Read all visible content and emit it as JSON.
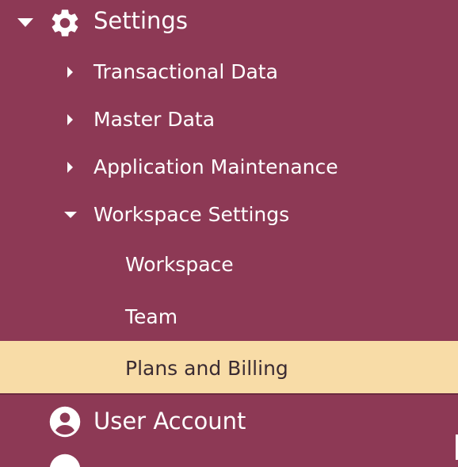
{
  "nav": {
    "settings": {
      "label": "Settings",
      "icon": "gear-icon"
    },
    "settings_children": [
      {
        "label": "Transactional Data"
      },
      {
        "label": "Master Data"
      },
      {
        "label": "Application Maintenance"
      }
    ],
    "workspace_settings": {
      "label": "Workspace Settings",
      "children": [
        {
          "label": "Workspace"
        },
        {
          "label": "Team"
        },
        {
          "label": "Plans and Billing",
          "selected": true
        }
      ]
    },
    "user_account": {
      "label": "User Account",
      "icon": "user-circle-icon"
    },
    "colors": {
      "sidebar_bg": "#8d3955",
      "selected_bg": "#f8dca7",
      "text": "#ffffff",
      "selected_text": "#3a2b32"
    }
  }
}
